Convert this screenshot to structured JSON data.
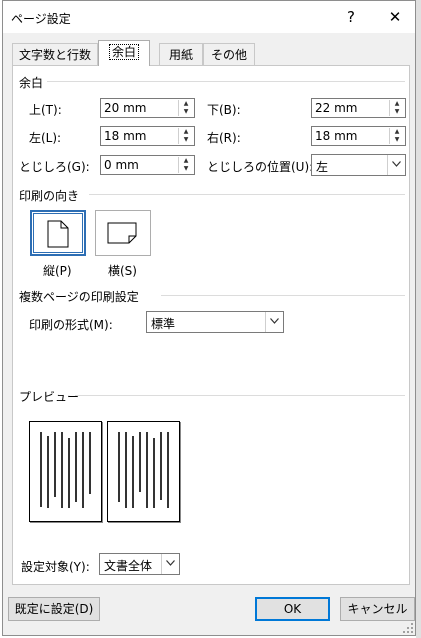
{
  "window": {
    "title": "ページ設定",
    "help_glyph": "?",
    "close_glyph": "✕"
  },
  "tabs": [
    {
      "label": "文字数と行数"
    },
    {
      "label": "余白"
    },
    {
      "label": "用紙"
    },
    {
      "label": "その他"
    }
  ],
  "margins": {
    "section_title": "余白",
    "top": {
      "label": "上(T):",
      "value": "20 mm"
    },
    "bottom": {
      "label": "下(B):",
      "value": "22 mm"
    },
    "left": {
      "label": "左(L):",
      "value": "18 mm"
    },
    "right": {
      "label": "右(R):",
      "value": "18 mm"
    },
    "gutter": {
      "label": "とじしろ(G):",
      "value": "0 mm"
    },
    "gutter_position": {
      "label": "とじしろの位置(U):",
      "value": "左"
    }
  },
  "orientation": {
    "section_title": "印刷の向き",
    "portrait_label": "縦(P)",
    "landscape_label": "横(S)",
    "selected": "portrait"
  },
  "multiple_pages": {
    "section_title": "複数ページの印刷設定",
    "label": "印刷の形式(M):",
    "value": "標準"
  },
  "preview": {
    "section_title": "プレビュー"
  },
  "apply_to": {
    "label": "設定対象(Y):",
    "value": "文書全体"
  },
  "buttons": {
    "default": "既定に設定(D)",
    "ok": "OK",
    "cancel": "キャンセル"
  },
  "colors": {
    "accent": "#0078d7",
    "selection": "#2d6eb4",
    "dialog_bg": "#f0f0f0"
  }
}
